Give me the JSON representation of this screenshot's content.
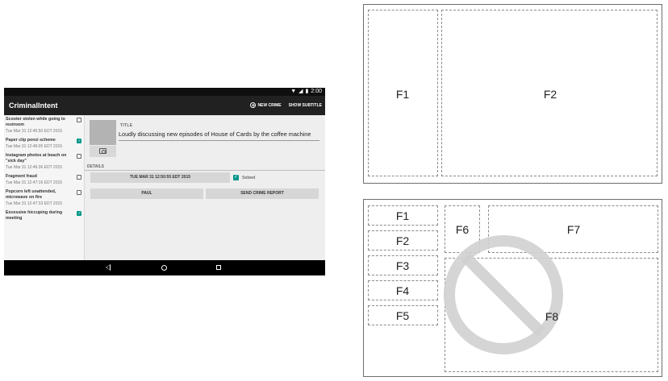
{
  "tablet": {
    "status_time": "2:00",
    "app_title": "CriminalIntent",
    "actions": {
      "new_crime": "NEW CRIME",
      "show_subtitle": "SHOW SUBTITLE"
    },
    "crimes": [
      {
        "title": "Scooter stolen while going to restroom",
        "date": "Tue Mar 31 12:45:50 EDT 2015",
        "solved": false
      },
      {
        "title": "Paper clip ponzi scheme",
        "date": "Tue Mar 31 12:46:05 EDT 2015",
        "solved": true
      },
      {
        "title": "Instagram photos at beach on \"sick day\"",
        "date": "Tue Mar 31 12:46:36 EDT 2015",
        "solved": false
      },
      {
        "title": "Fragment fraud",
        "date": "Tue Mar 31 12:47:16 EDT 2015",
        "solved": false
      },
      {
        "title": "Popcorn left unattended, microwave on fire",
        "date": "Tue Mar 31 12:47:33 EDT 2015",
        "solved": false
      },
      {
        "title": "Excessive hiccuping during meeting",
        "date": "",
        "solved": true
      }
    ],
    "detail": {
      "title_label": "TITLE",
      "title_value": "Loudly discussing new episodes of House of Cards by the coffee machine",
      "details_label": "DETAILS",
      "date_button": "TUE MAR 31 12:50:55 EDT 2015",
      "solved_label": "Solved",
      "solved": true,
      "suspect_button": "PAUL",
      "report_button": "SEND CRIME REPORT"
    }
  },
  "diagram_top": {
    "labels": [
      "F1",
      "F2"
    ]
  },
  "diagram_bottom": {
    "labels": [
      "F1",
      "F2",
      "F3",
      "F4",
      "F5",
      "F6",
      "F7",
      "F8"
    ]
  },
  "colors": {
    "accent": "#009688",
    "actionbar": "#212121",
    "no_sign": "#d0d0d0"
  }
}
